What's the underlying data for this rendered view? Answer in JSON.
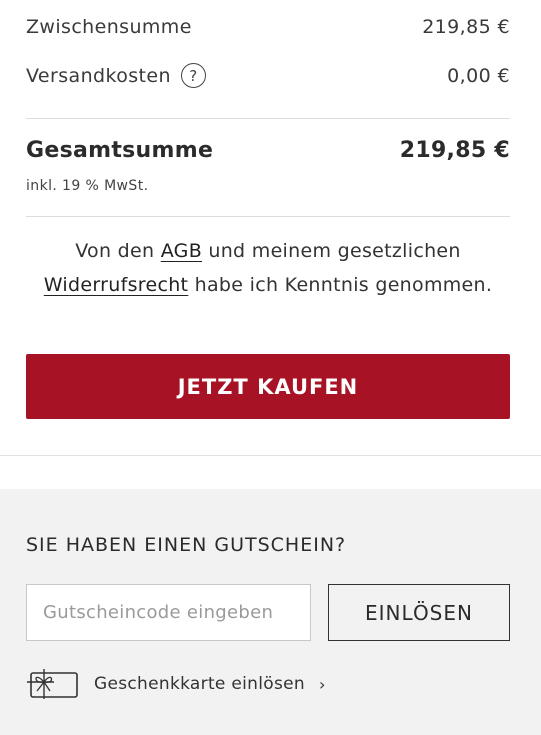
{
  "summary": {
    "subtotal_label": "Zwischensumme",
    "subtotal_value": "219,85 €",
    "shipping_label": "Versandkosten",
    "shipping_help": "?",
    "shipping_value": "0,00 €",
    "total_label": "Gesamtsumme",
    "total_value": "219,85 €",
    "vat_note": "inkl. 19 % MwSt."
  },
  "legal": {
    "part1": "Von den ",
    "agb_link": "AGB",
    "part2": " und meinem gesetzlichen ",
    "withdrawal_link": "Widerrufsrecht",
    "part3": " habe ich Kenntnis genommen."
  },
  "checkout": {
    "buy_label": "JETZT KAUFEN",
    "accent_color": "#a71325"
  },
  "voucher": {
    "title": "SIE HABEN EINEN GUTSCHEIN?",
    "input_placeholder": "Gutscheincode eingeben",
    "input_value": "",
    "redeem_label": "EINLÖSEN",
    "giftcard_label": "Geschenkkarte einlösen",
    "giftcard_icon": "gift-card-icon",
    "chevron": "›"
  }
}
